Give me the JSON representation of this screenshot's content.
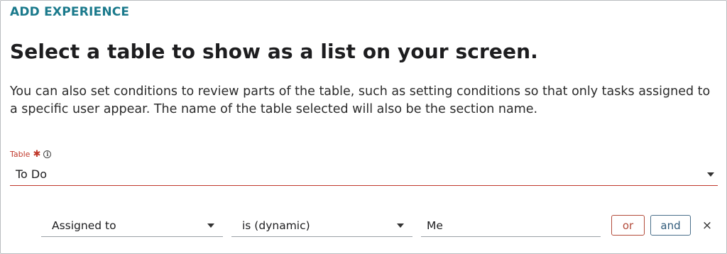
{
  "header": {
    "eyebrow": "ADD EXPERIENCE",
    "title": "Select a table to show as a list on your screen.",
    "description": "You can also set conditions to review parts of the table, such as setting conditions so that only tasks assigned to a specific user appear. The name of the table selected will also be the section name."
  },
  "table_field": {
    "label": "Table",
    "required_marker": "✱",
    "info_icon": "i",
    "value": "To Do"
  },
  "condition": {
    "field_value": "Assigned to",
    "operator_value": "is (dynamic)",
    "value": "Me",
    "or_label": "or",
    "and_label": "and",
    "remove_glyph": "×"
  },
  "colors": {
    "accent": "#1b7a8c",
    "required": "#c0392b",
    "or_button": "#b34b3a",
    "and_button": "#2f5a7a"
  }
}
